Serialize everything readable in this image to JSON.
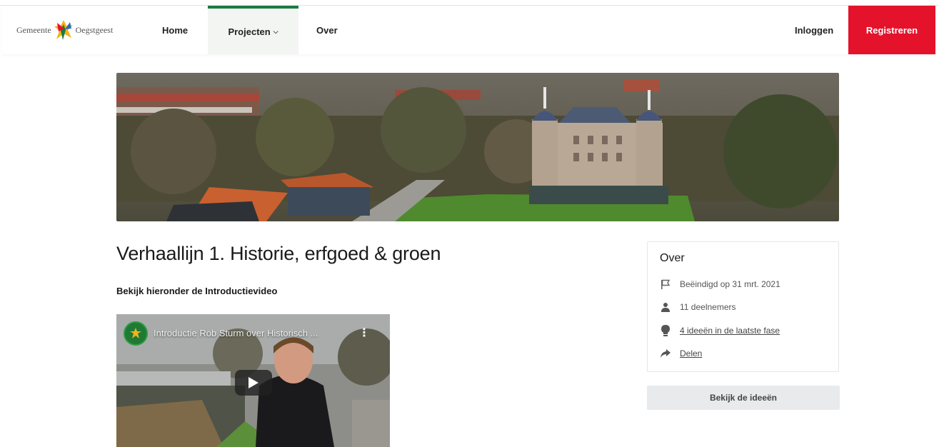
{
  "header": {
    "logo_left": "Gemeente",
    "logo_right": "Oegstgeest",
    "nav": {
      "home": "Home",
      "projecten": "Projecten",
      "over": "Over",
      "login": "Inloggen",
      "register": "Registreren"
    },
    "active_color": "#1d7a3f",
    "register_color": "#e4132b"
  },
  "main": {
    "title": "Verhaallijn 1. Historie, erfgoed & groen",
    "subtitle": "Bekijk hieronder de Introductievideo",
    "video": {
      "title": "Introductie Rob Sturm over Historisch ...",
      "icons": [
        "channel-avatar-icon",
        "more-vert-icon",
        "play-icon"
      ]
    }
  },
  "sidebar": {
    "title": "Over",
    "items": [
      {
        "icon": "flag-icon",
        "text": "Beëindigd op 31 mrt. 2021"
      },
      {
        "icon": "person-icon",
        "text": "11 deelnemers"
      },
      {
        "icon": "lightbulb-icon",
        "text": "4 ideeën in de laatste fase"
      },
      {
        "icon": "share-icon",
        "text": "Delen"
      }
    ],
    "button": "Bekijk de ideeën"
  }
}
